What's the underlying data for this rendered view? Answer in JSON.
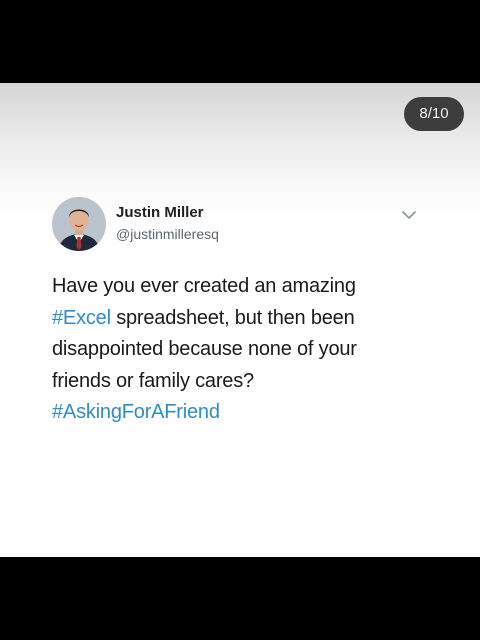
{
  "counter": "8/10",
  "tweet": {
    "author_name": "Justin Miller",
    "author_handle": "@justinmilleresq",
    "text_1": "Have you ever created an amazing",
    "hashtag_1": "#Excel",
    "text_2": " spreadsheet, but then been",
    "text_3": "disappointed because none of your",
    "text_4": "friends or family cares?",
    "hashtag_2": "#AskingForAFriend"
  },
  "icons": {
    "more": "chevron-down-icon",
    "avatar": "avatar"
  },
  "colors": {
    "hashtag": "#2f8cc8",
    "background_bars": "#000000",
    "counter_pill": "#3d3d3d"
  }
}
